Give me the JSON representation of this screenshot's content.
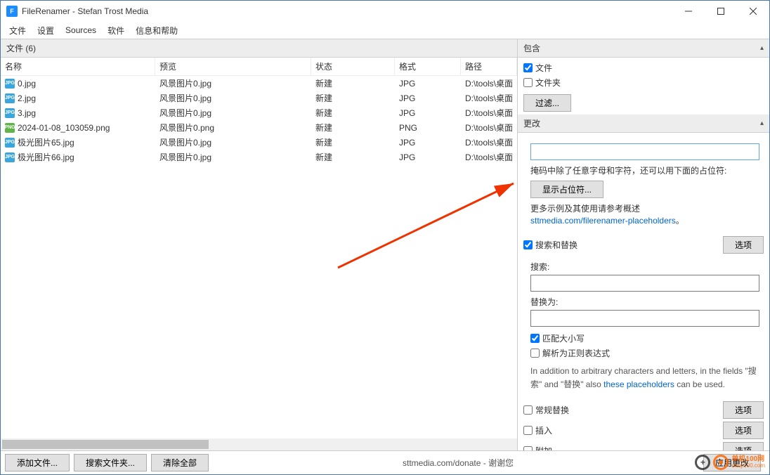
{
  "window": {
    "title": "FileRenamer - Stefan Trost Media",
    "app_icon": "F"
  },
  "menu": {
    "items": [
      "文件",
      "设置",
      "Sources",
      "软件",
      "信息和帮助"
    ]
  },
  "left": {
    "header": "文件 (6)",
    "columns": {
      "name": "名称",
      "preview": "预览",
      "status": "状态",
      "format": "格式",
      "path": "路径"
    },
    "rows": [
      {
        "ext": "jpg",
        "name": "0.jpg",
        "preview": "风景图片0.jpg",
        "status": "新建",
        "format": "JPG",
        "path": "D:\\tools\\桌面"
      },
      {
        "ext": "jpg",
        "name": "2.jpg",
        "preview": "风景图片0.jpg",
        "status": "新建",
        "format": "JPG",
        "path": "D:\\tools\\桌面"
      },
      {
        "ext": "jpg",
        "name": "3.jpg",
        "preview": "风景图片0.jpg",
        "status": "新建",
        "format": "JPG",
        "path": "D:\\tools\\桌面"
      },
      {
        "ext": "png",
        "name": "2024-01-08_103059.png",
        "preview": "风景图片0.png",
        "status": "新建",
        "format": "PNG",
        "path": "D:\\tools\\桌面"
      },
      {
        "ext": "jpg",
        "name": "极光图片65.jpg",
        "preview": "风景图片0.jpg",
        "status": "新建",
        "format": "JPG",
        "path": "D:\\tools\\桌面"
      },
      {
        "ext": "jpg",
        "name": "极光图片66.jpg",
        "preview": "风景图片0.jpg",
        "status": "新建",
        "format": "JPG",
        "path": "D:\\tools\\桌面"
      }
    ]
  },
  "right": {
    "include": {
      "title": "包含",
      "files": "文件",
      "files_checked": true,
      "folders": "文件夹",
      "folders_checked": false,
      "filter_btn": "过滤..."
    },
    "change": {
      "title": "更改",
      "mask_hint": "掩码中除了任意字母和字符，还可以用下面的占位符:",
      "show_placeholder": "显示占位符...",
      "more_examples": "更多示例及其使用请参考概述",
      "more_link": "sttmedia.com/filerenamer-placeholders",
      "sr": {
        "label": "搜索和替换",
        "checked": true,
        "options": "选项",
        "search_label": "搜索:",
        "search_value": "",
        "replace_label": "替换为:",
        "replace_value": "",
        "match_case": "匹配大小写",
        "match_case_checked": true,
        "regex": "解析为正则表达式",
        "regex_checked": false,
        "desc1": "In addition to arbitrary characters and letters, in the fields \"搜索\" and \"替换\" also ",
        "desc_link": "these placeholders",
        "desc2": " can be used."
      },
      "regular_replace": {
        "label": "常规替换",
        "checked": false,
        "options": "选项"
      },
      "insert": {
        "label": "插入",
        "checked": false,
        "options": "选项"
      },
      "append": {
        "label": "附加",
        "checked": false,
        "options": "选项"
      }
    }
  },
  "footer": {
    "add_files": "添加文件...",
    "search_files": "搜索文件夹...",
    "clear_all": "清除全部",
    "donate": "sttmedia.com/donate - 谢谢您",
    "apply": "应用更改"
  },
  "watermark": {
    "t1": "单机100网",
    "t2": "danji100.com"
  }
}
